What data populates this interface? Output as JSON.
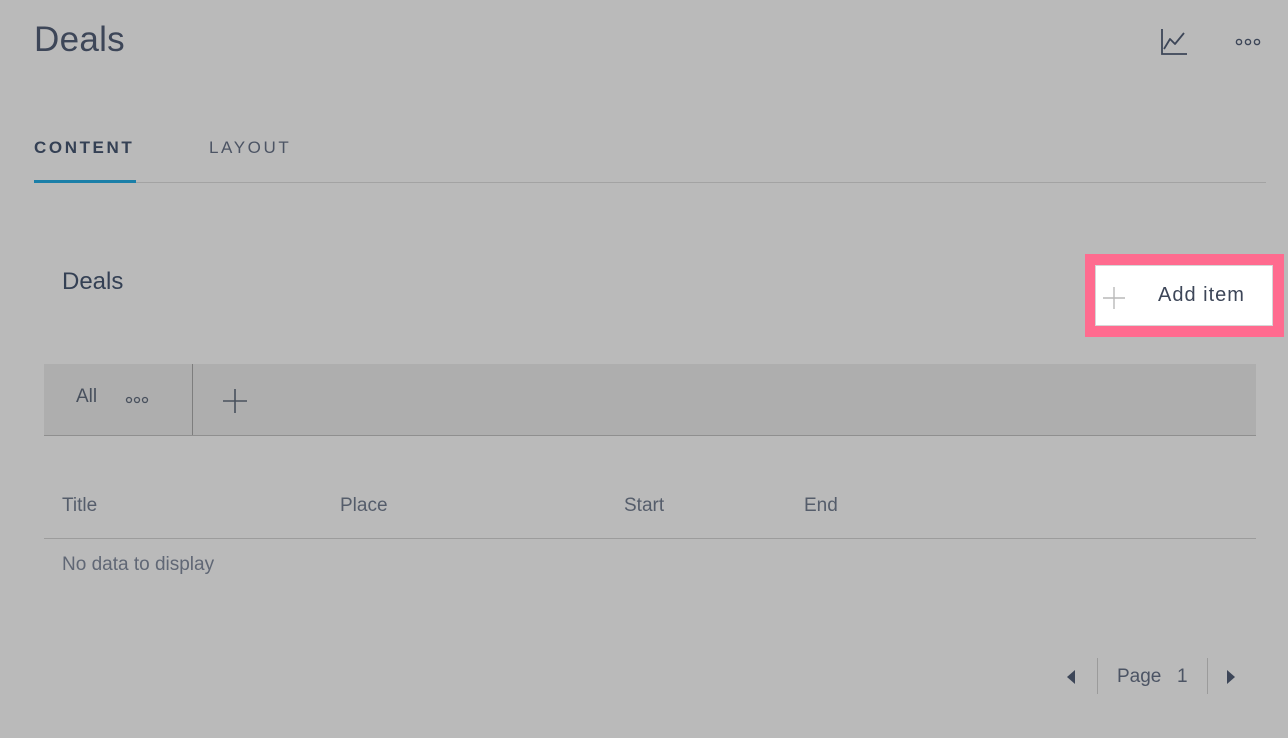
{
  "header": {
    "title": "Deals",
    "icons": [
      "chart-line-icon",
      "more-horizontal-icon"
    ]
  },
  "tabs": [
    {
      "label": "CONTENT",
      "active": true
    },
    {
      "label": "LAYOUT",
      "active": false
    }
  ],
  "section": {
    "title": "Deals",
    "add_button_label": "Add item"
  },
  "filters": {
    "active_view": "All",
    "icons": [
      "more-horizontal-icon",
      "plus-icon"
    ]
  },
  "table": {
    "columns": [
      "Title",
      "Place",
      "Start",
      "End"
    ],
    "rows": [],
    "empty_message": "No data to display"
  },
  "pagination": {
    "label": "Page",
    "current_page": "1"
  },
  "colors": {
    "background": "#bababa",
    "accent": "#1b7fa8",
    "highlight": "#ff6b8f",
    "text": "#3d4658"
  }
}
